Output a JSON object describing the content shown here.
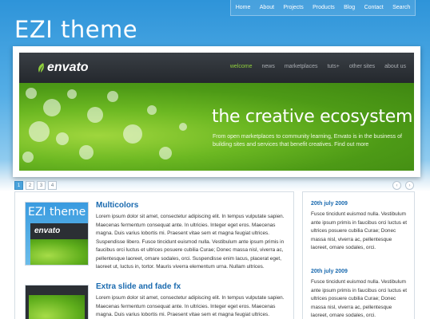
{
  "topnav": [
    "Home",
    "About",
    "Projects",
    "Products",
    "Blog",
    "Contact",
    "Search"
  ],
  "site": {
    "logo": "EZI theme"
  },
  "slider": {
    "brand": "envato",
    "menu": [
      "welcome",
      "news",
      "marketplaces",
      "tuts+",
      "other sites",
      "about us"
    ],
    "title": "the creative ecosystem",
    "desc": "From open marketplaces to community learning, Envato is in the business of building sites and services that benefit creatives. Find out more",
    "pages": [
      "1",
      "2",
      "3",
      "4"
    ],
    "prev": "‹",
    "next": "›"
  },
  "posts": [
    {
      "title": "Multicolors",
      "thumb_text": "EZI theme",
      "thumb_brand": "envato",
      "body": "Lorem ipsum dolor sit amet, consectetur adipiscing elit. In tempus vulputate sapien. Maecenas fermentum consequat ante. In ultricies. Integer eget eros. Maecenas magna. Duis varius lobortis mi. Praesent vitae sem et magna feugiat ultrices. Suspendisse libero. Fusce tincidunt euismod nulla. Vestibulum ante ipsum primis in faucibus orci luctus et ultrices posuere cubilia Curae; Donec massa nisl, viverra ac, pellentesque laoreet, ornare sodales, orci. Suspendisse enim lacus, placerat eget, laoreet ut, luctus in, tortor. Mauris viverra elementum urna. Nullam ultrices."
    },
    {
      "title": "Extra slide and fade fx",
      "body": "Lorem ipsum dolor sit amet, consectetur adipiscing elit. In tempus vulputate sapien. Maecenas fermentum consequat ante. In ultricies. Integer eget eros. Maecenas magna. Duis varius lobortis mi. Praesent vitae sem et magna feugiat ultrices."
    }
  ],
  "sidebar": [
    {
      "date": "20th july 2009",
      "text": "Fusce tincidunt euismod nulla. Vestibulum ante ipsum primis in faucibus orci luctus et ultrices posuere cubilia Curae; Donec massa nisl, viverra ac, pellentesque laoreet, ornare sodales, orci."
    },
    {
      "date": "20th july 2009",
      "text": "Fusce tincidunt euismod nulla. Vestibulum ante ipsum primis in faucibus orci luctus et ultrices posuere cubilia Curae; Donec massa nisl, viverra ac, pellentesque laoreet, ornare sodales, orci."
    }
  ]
}
